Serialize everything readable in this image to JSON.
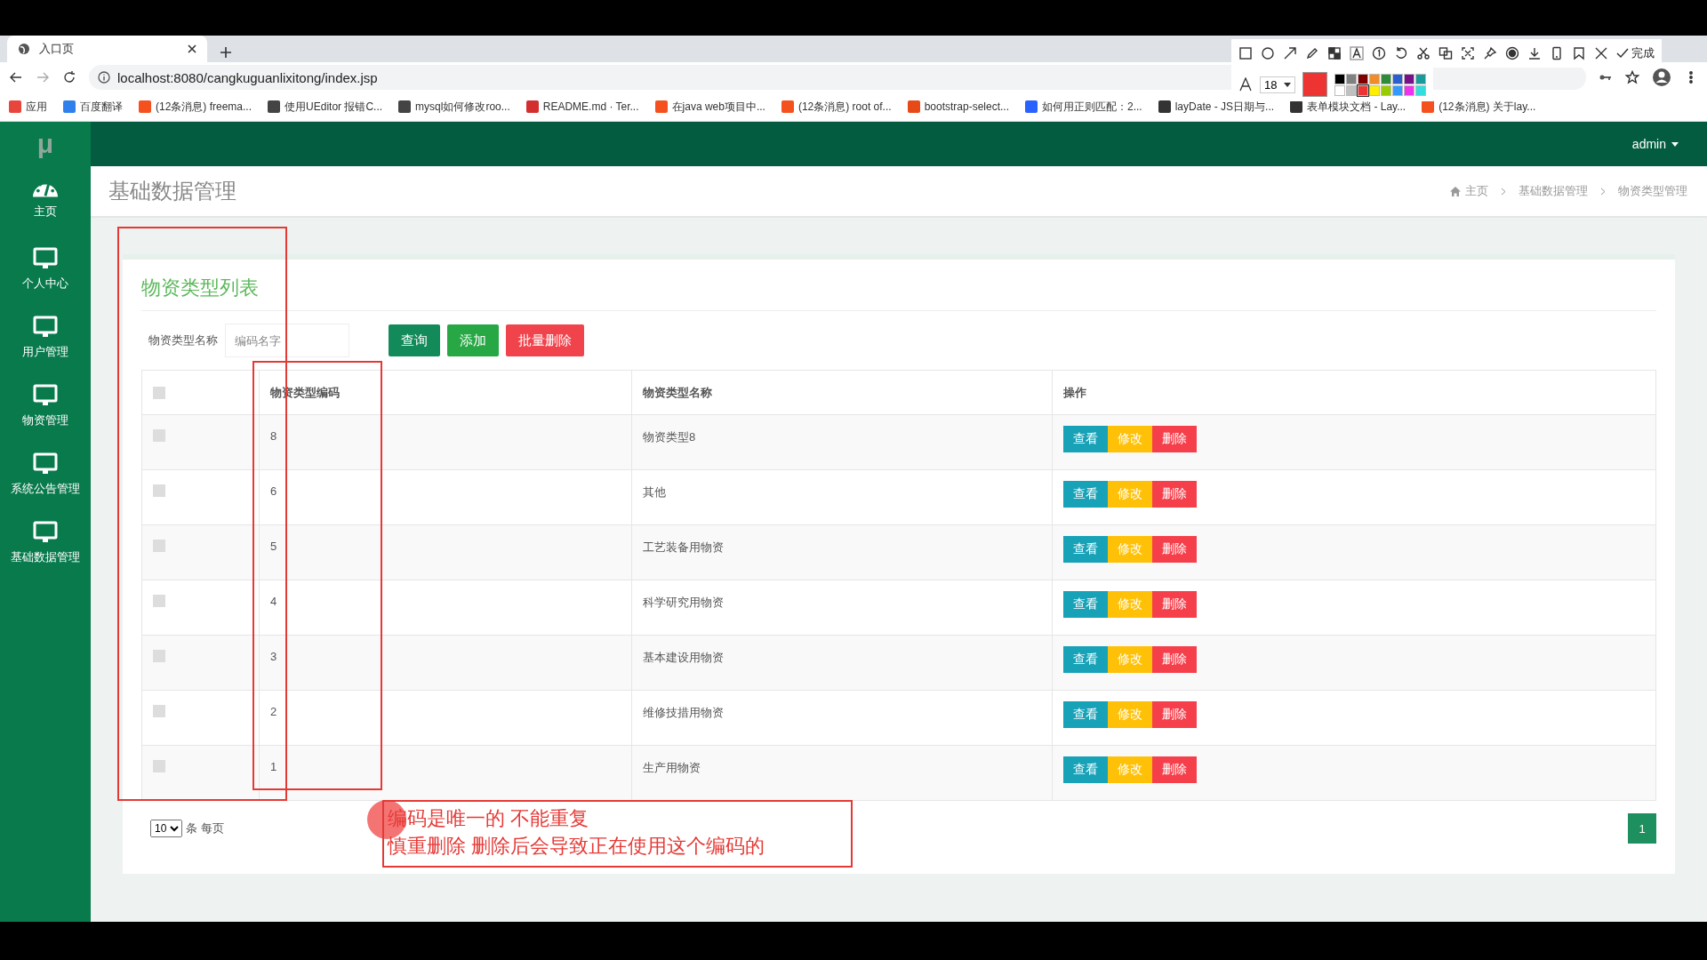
{
  "browser": {
    "tab_title": "入口页",
    "url": "localhost:8080/cangkuguanlixitong/index.jsp",
    "bookmarks": [
      {
        "label": "应用",
        "color": "#e8453c"
      },
      {
        "label": "百度翻译",
        "color": "#2f80ed"
      },
      {
        "label": "(12条消息) freema...",
        "color": "#f4511e"
      },
      {
        "label": "使用UEditor 报错C...",
        "color": "#444444"
      },
      {
        "label": "mysql如何修改roo...",
        "color": "#444444"
      },
      {
        "label": "README.md · Ter...",
        "color": "#d32f2f"
      },
      {
        "label": "在java web项目中...",
        "color": "#f4511e"
      },
      {
        "label": "(12条消息) root of...",
        "color": "#f4511e"
      },
      {
        "label": "bootstrap-select...",
        "color": "#e64a19"
      },
      {
        "label": "如何用正则匹配：2...",
        "color": "#2962ff"
      },
      {
        "label": "layDate - JS日期与...",
        "color": "#333333"
      },
      {
        "label": "表单模块文档 - Lay...",
        "color": "#333333"
      },
      {
        "label": "(12条消息) 关于lay...",
        "color": "#f4511e"
      }
    ]
  },
  "capture_toolbar": {
    "font_size": "18",
    "done": "完成",
    "palette": [
      {
        "color": "#000000",
        "selected": false
      },
      {
        "color": "#808080",
        "selected": false
      },
      {
        "color": "#800000",
        "selected": false
      },
      {
        "color": "#f28c28",
        "selected": false
      },
      {
        "color": "#2e8b3a",
        "selected": false
      },
      {
        "color": "#2a5fd0",
        "selected": false
      },
      {
        "color": "#7a0f8a",
        "selected": false
      },
      {
        "color": "#1a9a9a",
        "selected": false
      },
      {
        "color": "#ffffff",
        "selected": false
      },
      {
        "color": "#c0c0c0",
        "selected": false
      },
      {
        "color": "#ee3333",
        "selected": true
      },
      {
        "color": "#ffee00",
        "selected": false
      },
      {
        "color": "#99cc00",
        "selected": false
      },
      {
        "color": "#3399ff",
        "selected": false
      },
      {
        "color": "#ee33ee",
        "selected": false
      },
      {
        "color": "#33dddd",
        "selected": false
      }
    ]
  },
  "app": {
    "logo": "μ",
    "user": "admin"
  },
  "sidebar": {
    "items": [
      {
        "label": "主页",
        "kind": "dashboard"
      },
      {
        "label": "个人中心",
        "kind": "monitor"
      },
      {
        "label": "用户管理",
        "kind": "monitor"
      },
      {
        "label": "物资管理",
        "kind": "monitor"
      },
      {
        "label": "系统公告管理",
        "kind": "monitor"
      },
      {
        "label": "基础数据管理",
        "kind": "monitor"
      }
    ]
  },
  "page": {
    "title": "基础数据管理",
    "breadcrumb": [
      "主页",
      "基础数据管理",
      "物资类型管理"
    ]
  },
  "card": {
    "title": "物资类型列表",
    "search": {
      "label": "物资类型名称",
      "placeholder": "编码名字"
    },
    "buttons": [
      {
        "label": "查询",
        "kind": "search"
      },
      {
        "label": "添加",
        "kind": "add"
      },
      {
        "label": "批量删除",
        "kind": "delete"
      }
    ]
  },
  "table": {
    "header_checked": false,
    "columns": [
      "物资类型编码",
      "物资类型名称",
      "操作"
    ],
    "rows": [
      {
        "checked": false,
        "code": "8",
        "name": "物资类型8",
        "actions": [
          {
            "label": "查看",
            "kind": "view"
          },
          {
            "label": "修改",
            "kind": "edit"
          },
          {
            "label": "删除",
            "kind": "delete"
          }
        ]
      },
      {
        "checked": false,
        "code": "6",
        "name": "其他",
        "actions": [
          {
            "label": "查看",
            "kind": "view"
          },
          {
            "label": "修改",
            "kind": "edit"
          },
          {
            "label": "删除",
            "kind": "delete"
          }
        ]
      },
      {
        "checked": false,
        "code": "5",
        "name": "工艺装备用物资",
        "actions": [
          {
            "label": "查看",
            "kind": "view"
          },
          {
            "label": "修改",
            "kind": "edit"
          },
          {
            "label": "删除",
            "kind": "delete"
          }
        ]
      },
      {
        "checked": false,
        "code": "4",
        "name": "科学研究用物资",
        "actions": [
          {
            "label": "查看",
            "kind": "view"
          },
          {
            "label": "修改",
            "kind": "edit"
          },
          {
            "label": "删除",
            "kind": "delete"
          }
        ]
      },
      {
        "checked": false,
        "code": "3",
        "name": "基本建设用物资",
        "actions": [
          {
            "label": "查看",
            "kind": "view"
          },
          {
            "label": "修改",
            "kind": "edit"
          },
          {
            "label": "删除",
            "kind": "delete"
          }
        ]
      },
      {
        "checked": false,
        "code": "2",
        "name": "维修技措用物资",
        "actions": [
          {
            "label": "查看",
            "kind": "view"
          },
          {
            "label": "修改",
            "kind": "edit"
          },
          {
            "label": "删除",
            "kind": "delete"
          }
        ]
      },
      {
        "checked": false,
        "code": "1",
        "name": "生产用物资",
        "actions": [
          {
            "label": "查看",
            "kind": "view"
          },
          {
            "label": "修改",
            "kind": "edit"
          },
          {
            "label": "删除",
            "kind": "delete"
          }
        ]
      }
    ]
  },
  "pagination": {
    "page_size": "10",
    "page_size_label": "条 每页",
    "pages": [
      {
        "label": "1",
        "selected": true
      }
    ]
  },
  "annotation": {
    "lines": [
      "编码是唯一的 不能重复",
      "慎重删除 删除后会导致正在使用这个编码的"
    ]
  }
}
